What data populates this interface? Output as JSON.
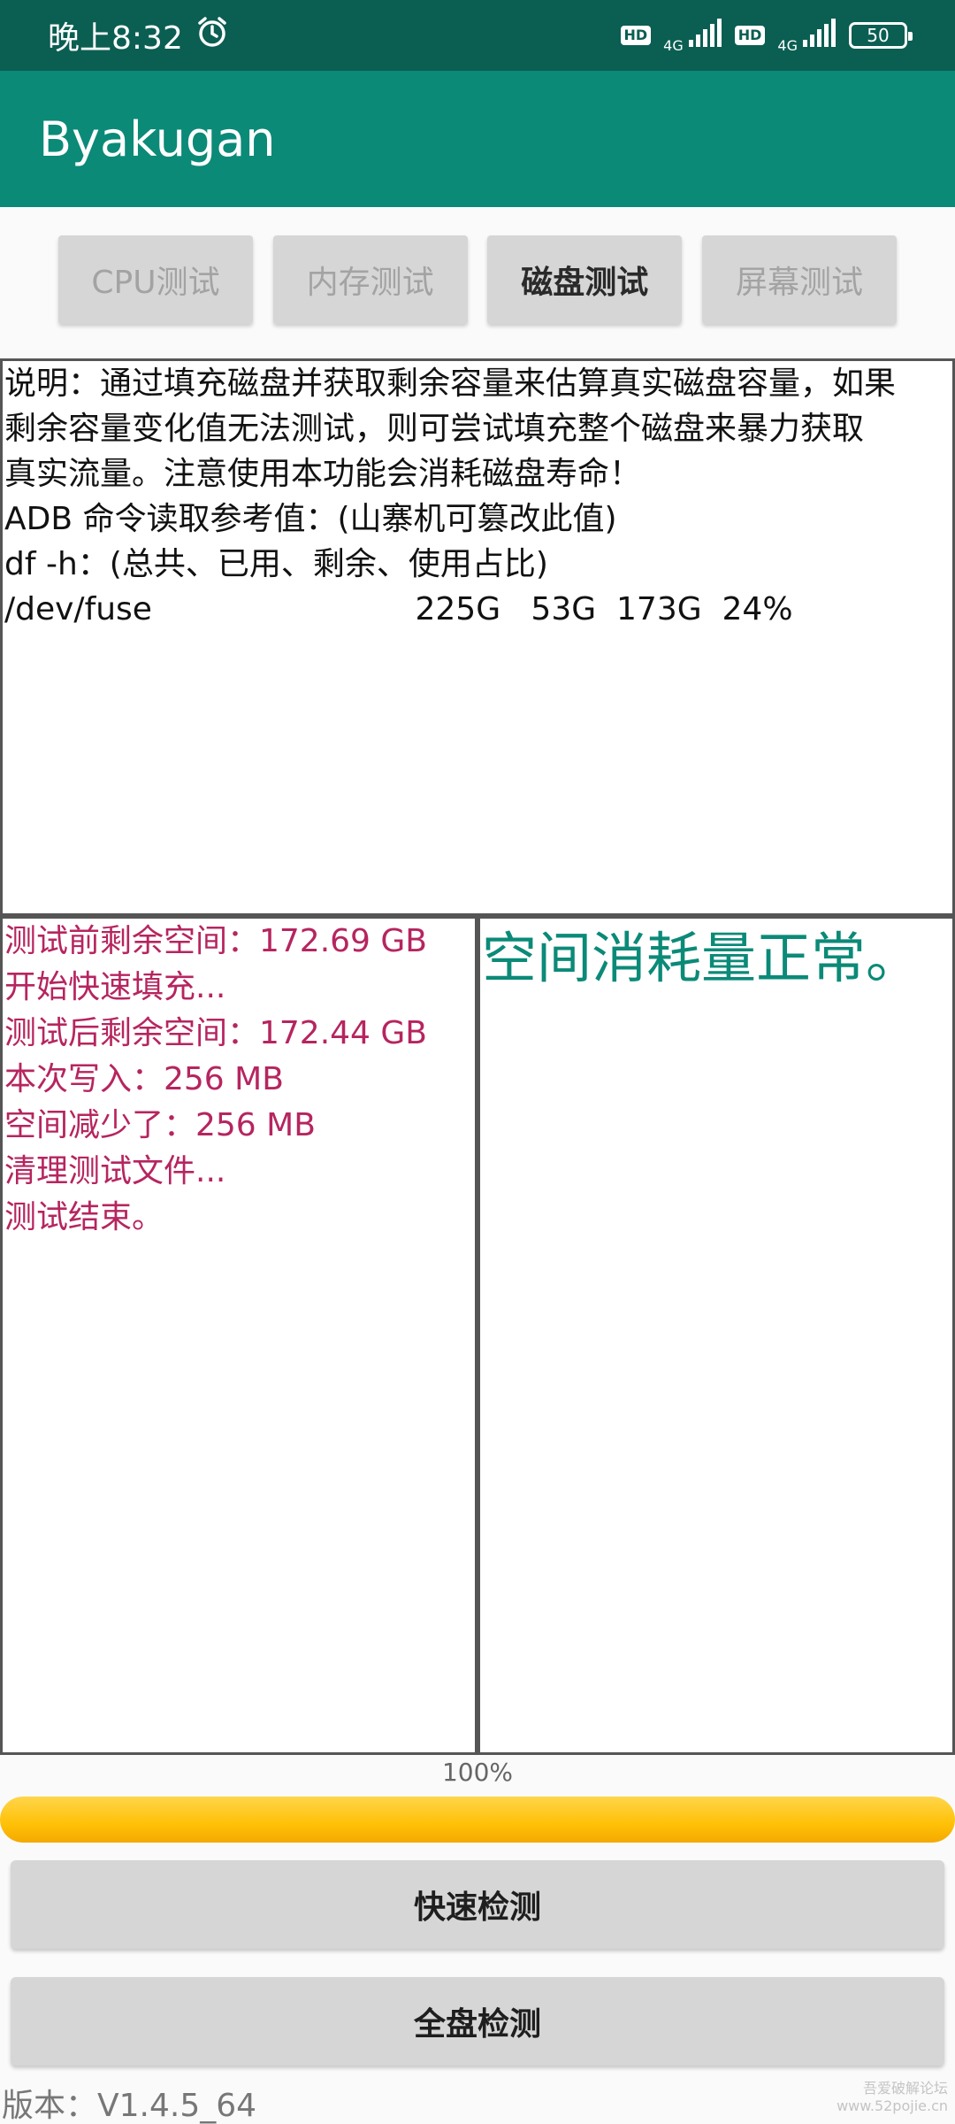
{
  "status_bar": {
    "time": "晚上8:32",
    "hd1": "HD",
    "net1": "4G",
    "hd2": "HD",
    "net2": "4G",
    "battery": "50"
  },
  "app_bar": {
    "title": "Byakugan"
  },
  "tabs": [
    {
      "label": "CPU测试",
      "active": false
    },
    {
      "label": "内存测试",
      "active": false
    },
    {
      "label": "磁盘测试",
      "active": true
    },
    {
      "label": "屏幕测试",
      "active": false
    }
  ],
  "description": {
    "lines": [
      "说明：通过填充磁盘并获取剩余容量来估算真实磁盘容量，如果",
      "剩余容量变化值无法测试，则可尝试填充整个磁盘来暴力获取",
      "真实流量。注意使用本功能会消耗磁盘寿命！",
      "ADB 命令读取参考值：(山寨机可篡改此值)",
      "df -h：(总共、已用、剩余、使用占比)",
      "/dev/fuse                          225G   53G  173G  24%"
    ]
  },
  "log": {
    "lines": [
      "测试前剩余空间：172.69 GB",
      "开始快速填充...",
      "测试后剩余空间：172.44 GB",
      "本次写入：256 MB",
      "空间减少了：256 MB",
      "清理测试文件...",
      "测试结束。"
    ]
  },
  "result": {
    "text": "空间消耗量正常。"
  },
  "progress": {
    "label": "100%",
    "value_percent": 100
  },
  "buttons": {
    "quick": "快速检测",
    "full": "全盘检测"
  },
  "version": "版本：V1.4.5_64",
  "watermark": {
    "line1": "吾爱破解论坛",
    "line2": "www.52pojie.cn"
  },
  "colors": {
    "status_bar": "#0b5e52",
    "app_bar": "#0b8a78",
    "log_text": "#b6255f",
    "result_text": "#0b8a78",
    "progress": "#ffc107"
  }
}
